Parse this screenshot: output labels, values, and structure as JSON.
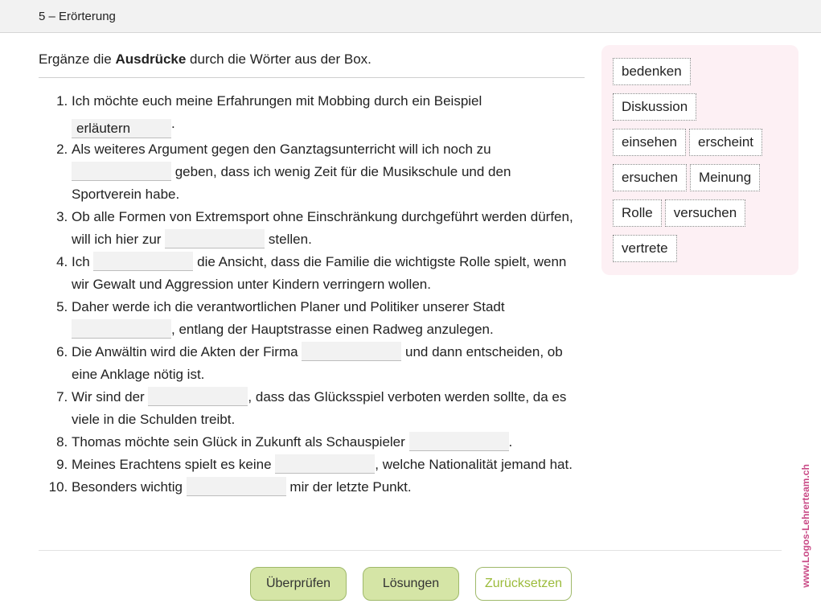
{
  "header": {
    "title": "5 – Erörterung"
  },
  "instruction": {
    "prefix": "Ergänze die ",
    "bold": "Ausdrücke",
    "suffix": " durch die Wörter aus der Box."
  },
  "items": [
    {
      "before": "Ich möchte euch meine Erfahrungen mit Mobbing durch ein Beispiel ",
      "gap_value": "erläutern",
      "after": "."
    },
    {
      "before": "Als weiteres Argument gegen den Ganztagsunterricht will ich noch zu ",
      "gap_value": "",
      "after": " geben, dass ich wenig Zeit für die Musikschule und den Sportverein habe."
    },
    {
      "before": "Ob alle Formen von Extremsport ohne Einschränkung durchgeführt werden dürfen, will ich hier zur ",
      "gap_value": "",
      "after": " stellen."
    },
    {
      "before": "Ich ",
      "gap_value": "",
      "after": " die Ansicht, dass die Familie die wichtigste Rolle spielt, wenn wir Gewalt und Aggression unter Kindern verringern wollen."
    },
    {
      "before": "Daher werde ich die verantwortlichen Planer und Politiker unserer Stadt ",
      "gap_value": "",
      "after": ", entlang der Hauptstrasse einen Radweg anzulegen."
    },
    {
      "before": "Die Anwältin wird die Akten der Firma ",
      "gap_value": "",
      "after": " und dann entscheiden, ob eine Anklage nötig ist."
    },
    {
      "before": "Wir sind der ",
      "gap_value": "",
      "after": ", dass das Glücksspiel verboten werden sollte, da es viele in die Schulden treibt."
    },
    {
      "before": "Thomas möchte sein Glück in Zukunft als Schauspieler ",
      "gap_value": "",
      "after": "."
    },
    {
      "before": "Meines Erachtens spielt es keine ",
      "gap_value": "",
      "after": ", welche Nationalität jemand hat."
    },
    {
      "before": "Besonders wichtig ",
      "gap_value": "",
      "after": " mir der letzte Punkt."
    }
  ],
  "word_box": {
    "rows": [
      [
        "bedenken"
      ],
      [
        "Diskussion"
      ],
      [
        "einsehen",
        "erscheint"
      ],
      [
        "ersuchen",
        "Meinung"
      ],
      [
        "Rolle",
        "versuchen"
      ],
      [
        "vertrete"
      ]
    ]
  },
  "buttons": {
    "check": "Überprüfen",
    "solutions": "Lösungen",
    "reset": "Zurücksetzen"
  },
  "side_brand": "www.Logos-Lehrerteam.ch",
  "colors": {
    "word_box_bg": "#fdf0f4",
    "button_green": "#d5e5a6",
    "brand_pink": "#c94a86"
  }
}
